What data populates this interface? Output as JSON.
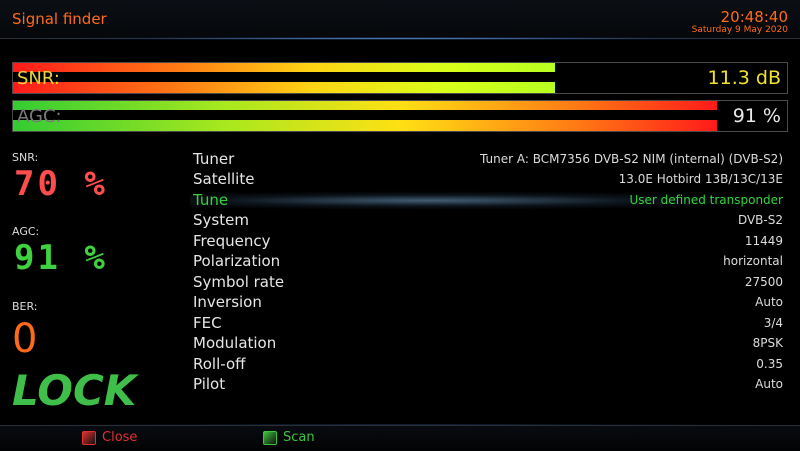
{
  "header": {
    "title": "Signal finder",
    "time": "20:48:40",
    "date": "Saturday  9 May 2020"
  },
  "bars": {
    "snr": {
      "label": "SNR:",
      "value_text": "11.3 dB",
      "fill_fraction": 0.7
    },
    "agc": {
      "label": "AGC:",
      "value_text": "91 %",
      "fill_fraction": 0.91
    }
  },
  "stats": {
    "snr_label": "SNR:",
    "snr_value": "70 %",
    "agc_label": "AGC:",
    "agc_value": "91 %",
    "ber_label": "BER:",
    "ber_value": "0",
    "lock_text": "LOCK"
  },
  "info": [
    {
      "key": "Tuner",
      "value": "Tuner A: BCM7356 DVB-S2 NIM (internal) (DVB-S2)"
    },
    {
      "key": "Satellite",
      "value": "13.0E Hotbird 13B/13C/13E"
    },
    {
      "key": "Tune",
      "value": "User defined transponder",
      "selected": true
    },
    {
      "key": "System",
      "value": "DVB-S2"
    },
    {
      "key": "Frequency",
      "value": "11449"
    },
    {
      "key": "Polarization",
      "value": "horizontal"
    },
    {
      "key": "Symbol rate",
      "value": "27500"
    },
    {
      "key": "Inversion",
      "value": "Auto"
    },
    {
      "key": "FEC",
      "value": "3/4"
    },
    {
      "key": "Modulation",
      "value": "8PSK"
    },
    {
      "key": "Roll-off",
      "value": "0.35"
    },
    {
      "key": "Pilot",
      "value": "Auto"
    }
  ],
  "footer": {
    "close_label": "Close",
    "close_color": "#e03030",
    "scan_label": "Scan",
    "scan_color": "#3ec43e"
  }
}
